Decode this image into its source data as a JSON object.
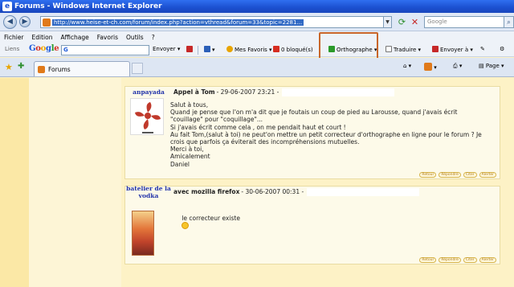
{
  "window": {
    "title": "Forums - Windows Internet Explorer"
  },
  "address": {
    "url": "http://www.heise-et-ch.com/forum/index.php?action=vthread&forum=33&topic=2281...",
    "search_placeholder": "Google"
  },
  "menu": {
    "items": [
      "Fichier",
      "Edition",
      "Affichage",
      "Favoris",
      "Outils",
      "?"
    ]
  },
  "gtoolbar": {
    "liens": "Liens",
    "logo_letters": [
      "G",
      "o",
      "o",
      "g",
      "l",
      "e"
    ],
    "search_value": "G",
    "envoyer": "Envoyer",
    "mes_favoris": "Mes Favoris",
    "bloques": "0 bloqué(s)",
    "orthographe": "Orthographe",
    "traduire": "Traduire",
    "envoyer_a": "Envoyer à"
  },
  "tabbar": {
    "tab_label": "Forums",
    "page_label": "Page"
  },
  "posts": [
    {
      "author": "anpayada",
      "subject": "Appel à Tom",
      "date": "- 29-06-2007 23:21 -",
      "body": "Salut à tous,\nQuand je pense que l'on m'a dit que je foutais un coup de pied au Larousse, quand j'avais écrit\n\"couillage\" pour \"coquillage\"...\nSi j'avais écrit comme cela , on me pendait haut et court !\nAu fait Tom,(salut à toi) ne peut'on mettre un petit correcteur d'orthographe en ligne pour le forum ? Je\ncrois que parfois ça éviterait des incompréhensions mutuelles.\nMerci à toi,\nAmicalement\nDaniel",
      "actions": [
        "Retour",
        "Répondre",
        "Citer",
        "Alerter"
      ]
    },
    {
      "author": "batelier de la vodka",
      "subject": "avec mozilla firefox",
      "date": "- 30-06-2007 00:31 -",
      "body": "le correcteur existe",
      "actions": [
        "Retour",
        "Répondre",
        "Citer",
        "Alerter"
      ]
    }
  ],
  "colors": {
    "titlebar": "#1b4fcf",
    "highlight": "#c9662a",
    "author": "#2233aa",
    "page_bg": "#fdf2c6"
  }
}
